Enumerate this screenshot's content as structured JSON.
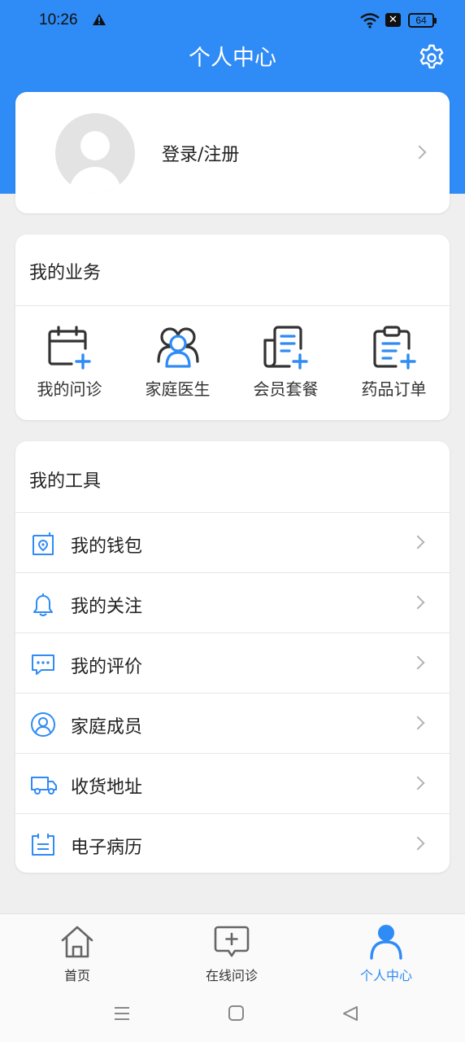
{
  "status_bar": {
    "time": "10:26",
    "battery": "64"
  },
  "header": {
    "title": "个人中心"
  },
  "profile": {
    "login_label": "登录/注册"
  },
  "business": {
    "title": "我的业务",
    "items": [
      {
        "label": "我的问诊",
        "icon": "calendar-plus-icon"
      },
      {
        "label": "家庭医生",
        "icon": "doctors-group-icon"
      },
      {
        "label": "会员套餐",
        "icon": "document-plus-icon"
      },
      {
        "label": "药品订单",
        "icon": "clipboard-plus-icon"
      }
    ]
  },
  "tools": {
    "title": "我的工具",
    "items": [
      {
        "label": "我的钱包",
        "icon": "wallet-icon"
      },
      {
        "label": "我的关注",
        "icon": "bell-icon"
      },
      {
        "label": "我的评价",
        "icon": "comment-icon"
      },
      {
        "label": "家庭成员",
        "icon": "user-circle-icon"
      },
      {
        "label": "收货地址",
        "icon": "truck-icon"
      },
      {
        "label": "电子病历",
        "icon": "medical-record-icon"
      }
    ]
  },
  "bottom_nav": {
    "items": [
      {
        "label": "首页",
        "icon": "home-icon",
        "active": false
      },
      {
        "label": "在线问诊",
        "icon": "chat-plus-icon",
        "active": false
      },
      {
        "label": "个人中心",
        "icon": "person-icon",
        "active": true
      }
    ]
  },
  "colors": {
    "primary": "#2f8bf5",
    "background": "#efefef",
    "icon_dark": "#333333"
  }
}
